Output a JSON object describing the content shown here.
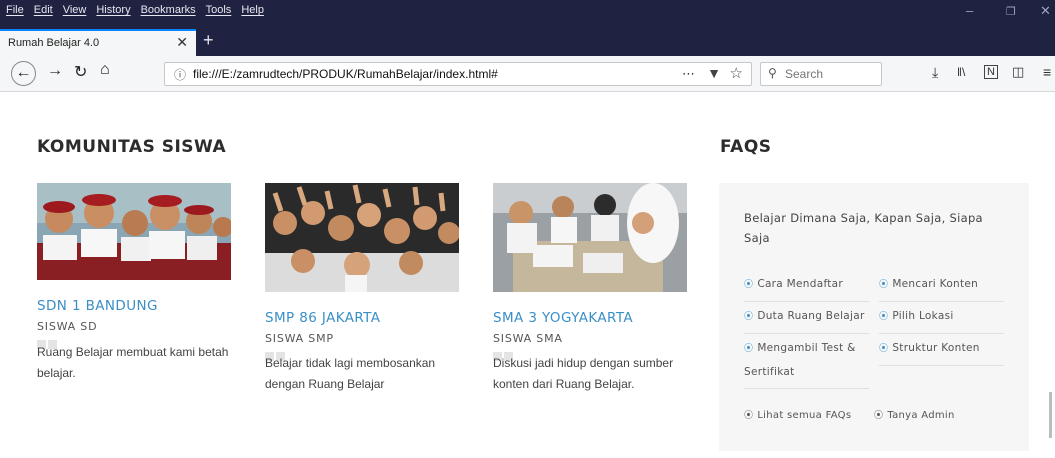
{
  "browser": {
    "menu": [
      "File",
      "Edit",
      "View",
      "History",
      "Bookmarks",
      "Tools",
      "Help"
    ],
    "tab_title": "Rumah Belajar 4.0",
    "url": "file:///E:/zamrudtech/PRODUK/RumahBelajar/index.html#",
    "search_placeholder": "Search",
    "accent_color": "#0a84ff",
    "chrome_color": "#1f2240"
  },
  "community": {
    "heading": "KOMUNITAS SISWA",
    "cards": [
      {
        "name": "SDN 1 BANDUNG",
        "level": "SISWA SD",
        "testimonial": "Ruang Belajar membuat kami betah belajar."
      },
      {
        "name": "SMP 86 JAKARTA",
        "level": "SISWA SMP",
        "testimonial": "Belajar tidak lagi membosankan dengan Ruang Belajar"
      },
      {
        "name": "SMA 3 YOGYAKARTA",
        "level": "SISWA SMA",
        "testimonial": "Diskusi jadi hidup dengan sumber konten dari Ruang Belajar."
      }
    ]
  },
  "faqs": {
    "heading": "FAQS",
    "intro": "Belajar Dimana Saja, Kapan Saja, Siapa Saja",
    "links": [
      "Cara Mendaftar",
      "Mencari Konten",
      "Duta Ruang Belajar",
      "Pilih Lokasi",
      "Mengambil Test & Sertifikat",
      "Struktur Konten"
    ],
    "footer_links": [
      "Lihat semua FAQs",
      "Tanya Admin"
    ],
    "link_color": "#3a8fc7"
  }
}
